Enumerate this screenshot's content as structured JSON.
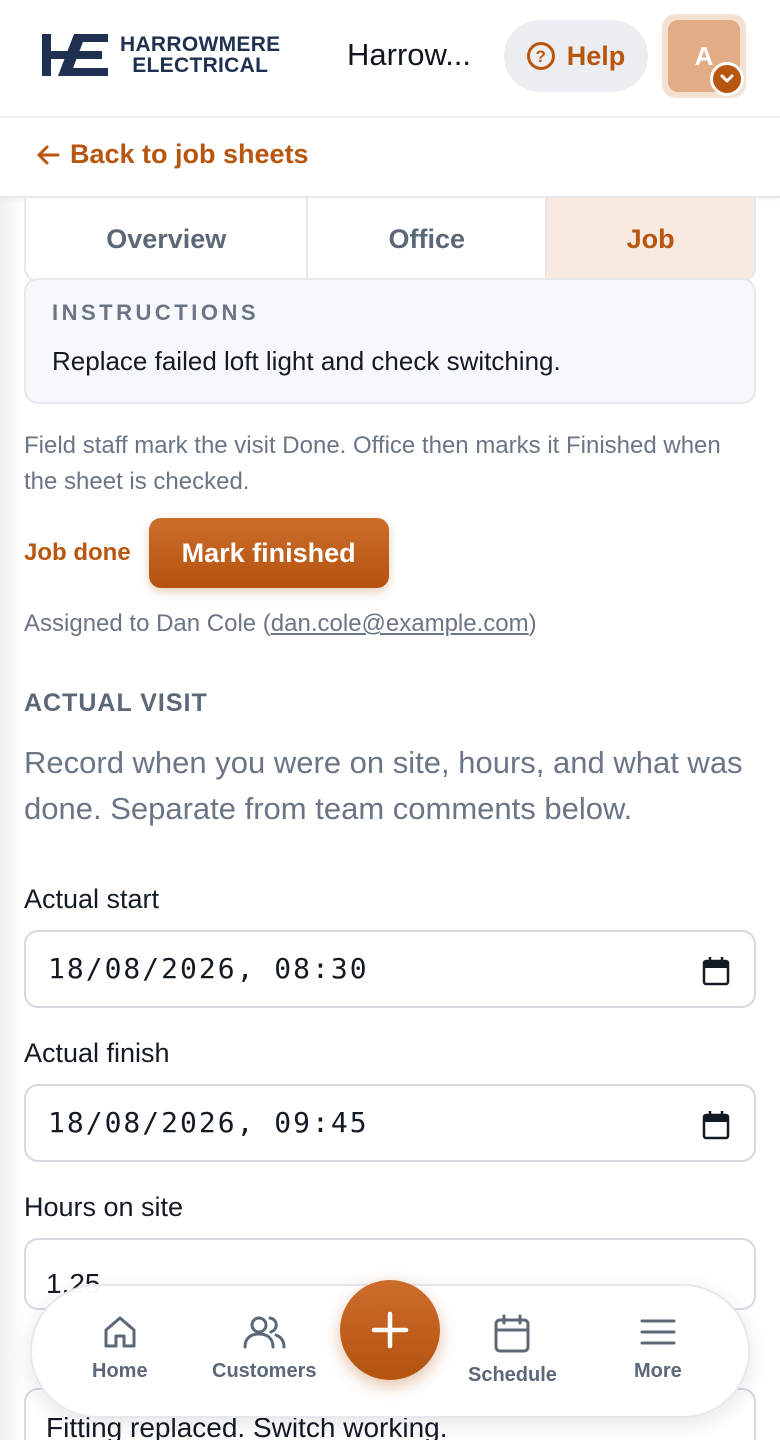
{
  "colors": {
    "accent": "#b8560f",
    "muted": "#6b7586",
    "tab_active_bg": "#f7eae0",
    "brand_navy": "#1f3050"
  },
  "header": {
    "logo_line1": "HARROWMERE",
    "logo_line2": "ELECTRICAL",
    "app_title": "Harrow...",
    "help_label": "Help",
    "avatar_initial": "A"
  },
  "back": {
    "label": "Back to job sheets"
  },
  "tabs": [
    {
      "label": "Overview",
      "active": false
    },
    {
      "label": "Office",
      "active": false
    },
    {
      "label": "Job",
      "active": true
    }
  ],
  "instructions": {
    "heading": "INSTRUCTIONS",
    "text": "Replace failed loft light and check switching."
  },
  "workflow_note": "Field staff mark the visit Done. Office then marks it Finished when the sheet is checked.",
  "status": {
    "label": "Job done",
    "action_label": "Mark finished"
  },
  "assignment": {
    "prefix": "Assigned to Dan Cole (",
    "email": "dan.cole@example.com",
    "suffix": ")"
  },
  "actual_visit": {
    "heading": "ACTUAL VISIT",
    "description": "Record when you were on site, hours, and what was done. Separate from team comments below.",
    "start_label": "Actual start",
    "start_value": "18/08/2026, 08:30",
    "finish_label": "Actual finish",
    "finish_value": "18/08/2026, 09:45",
    "hours_label": "Hours on site",
    "hours_value": "1.25",
    "work_value": "Fitting replaced. Switch working."
  },
  "nav": {
    "home": "Home",
    "customers": "Customers",
    "schedule": "Schedule",
    "more": "More"
  }
}
